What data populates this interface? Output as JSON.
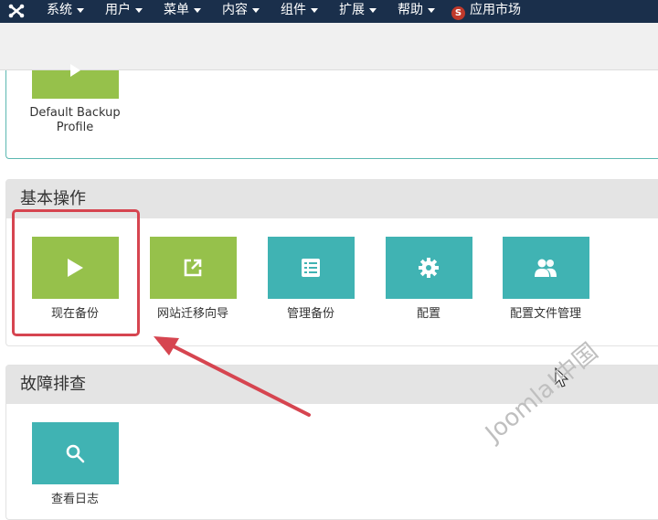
{
  "navbar": {
    "menus": [
      "系统",
      "用户",
      "菜单",
      "内容",
      "组件",
      "扩展",
      "帮助"
    ],
    "apps_label": "应用市场",
    "apps_badge": "S"
  },
  "profile": {
    "label": "Default Backup Profile"
  },
  "basic_ops": {
    "title": "基本操作",
    "tiles": [
      "现在备份",
      "网站迁移向导",
      "管理备份",
      "配置",
      "配置文件管理"
    ]
  },
  "troubleshoot": {
    "title": "故障排查",
    "tiles": [
      "查看日志"
    ]
  },
  "watermark": "Joomla!中国",
  "colors": {
    "navbar": "#1a2f4b",
    "tile_green": "#96c14b",
    "tile_teal": "#40b3b3",
    "annotation_red": "#d64550"
  }
}
